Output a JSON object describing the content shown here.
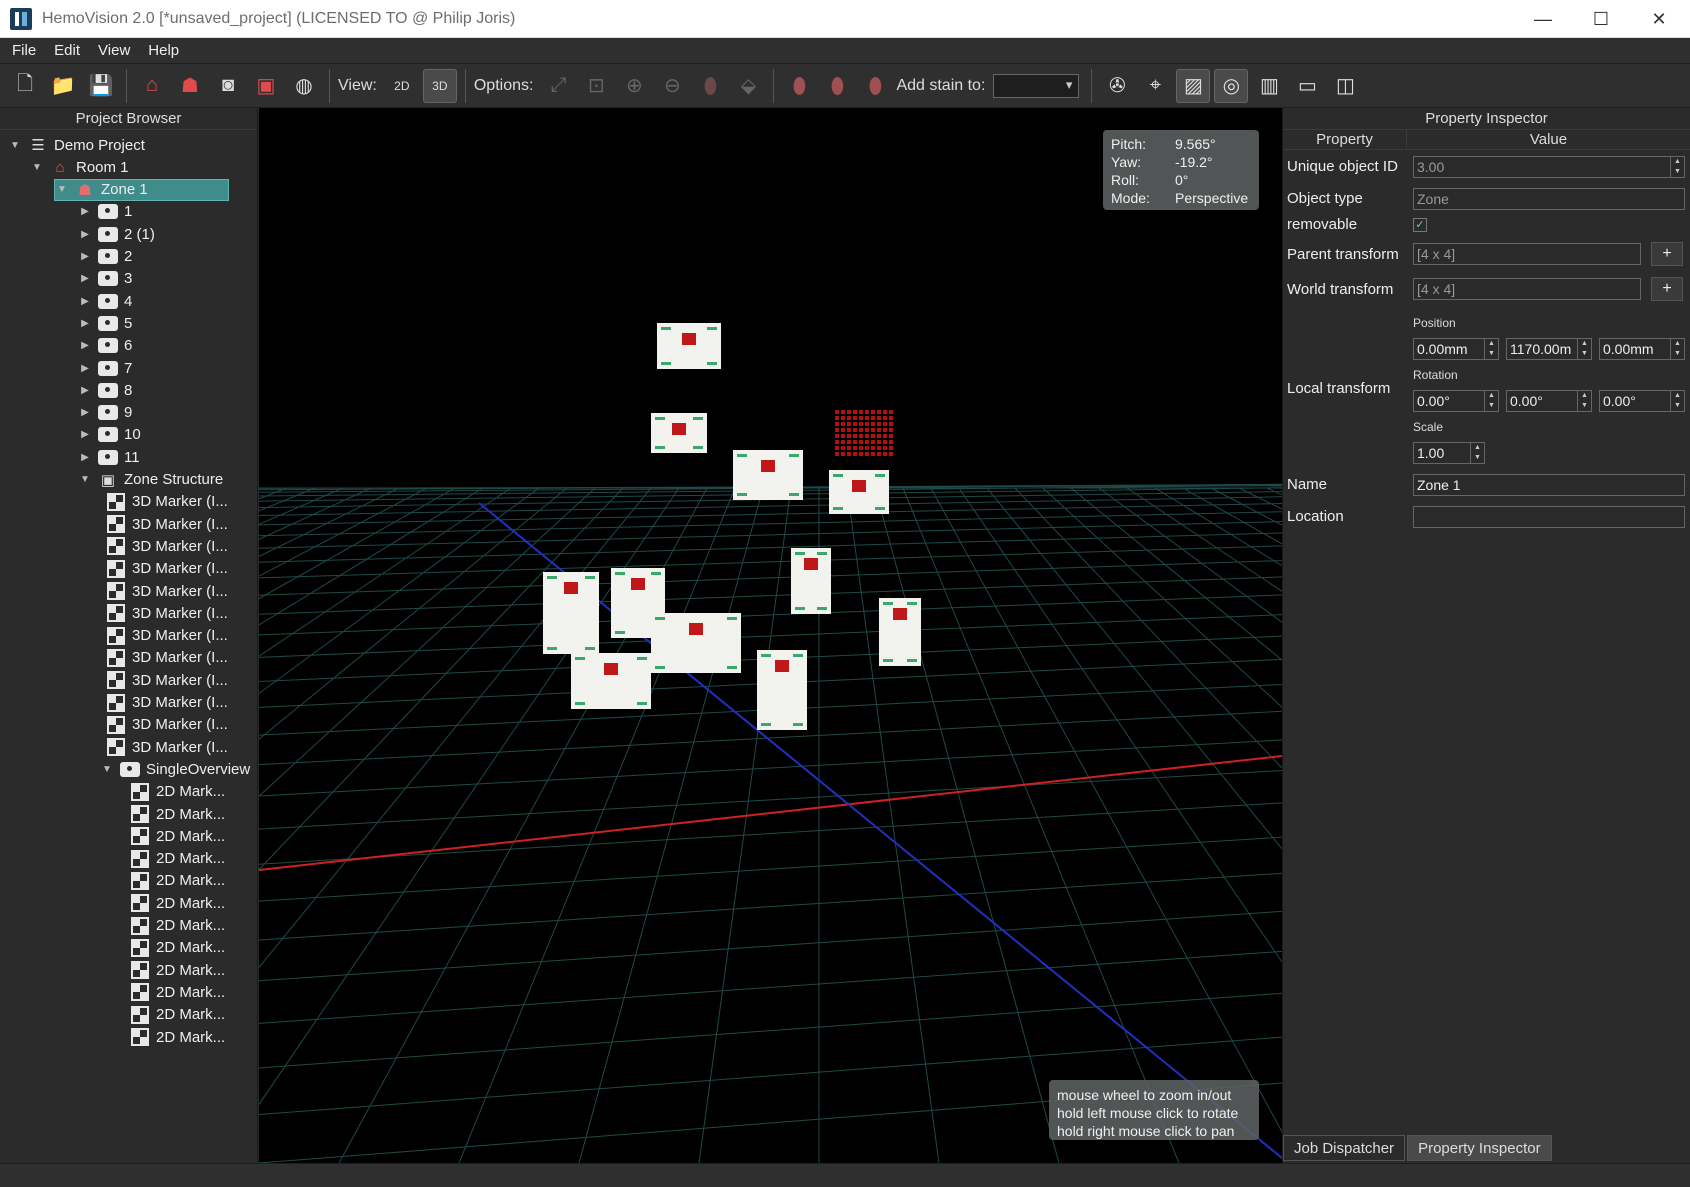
{
  "window": {
    "title": "HemoVision 2.0 [*unsaved_project] (LICENSED TO @ Philip Joris)"
  },
  "menu": [
    "File",
    "Edit",
    "View",
    "Help"
  ],
  "toolbar": {
    "view_label": "View:",
    "view_2d": "2D",
    "view_3d": "3D",
    "options_label": "Options:",
    "add_stain_label": "Add stain to:",
    "add_stain_value": ""
  },
  "project_browser": {
    "title": "Project Browser",
    "root": "Demo Project",
    "room": "Room 1",
    "zone": "Zone 1",
    "cameras": [
      "1",
      "2 (1)",
      "2",
      "3",
      "4",
      "5",
      "6",
      "7",
      "8",
      "9",
      "10",
      "11"
    ],
    "zone_structure": "Zone Structure",
    "markers_3d": [
      "3D Marker (I...",
      "3D Marker (I...",
      "3D Marker (I...",
      "3D Marker (I...",
      "3D Marker (I...",
      "3D Marker (I...",
      "3D Marker (I...",
      "3D Marker (I...",
      "3D Marker (I...",
      "3D Marker (I...",
      "3D Marker (I...",
      "3D Marker (I..."
    ],
    "overview": "SingleOverview",
    "markers_2d": [
      "2D Mark...",
      "2D Mark...",
      "2D Mark...",
      "2D Mark...",
      "2D Mark...",
      "2D Mark...",
      "2D Mark...",
      "2D Mark...",
      "2D Mark...",
      "2D Mark...",
      "2D Mark...",
      "2D Mark..."
    ]
  },
  "viewport": {
    "pitch_label": "Pitch:",
    "pitch": "9.565°",
    "yaw_label": "Yaw:",
    "yaw": "-19.2°",
    "roll_label": "Roll:",
    "roll": "0°",
    "mode_label": "Mode:",
    "mode": "Perspective",
    "hint_1": "mouse wheel to zoom in/out",
    "hint_2": "hold left mouse click to rotate",
    "hint_3": "hold right mouse click to pan"
  },
  "inspector": {
    "title": "Property Inspector",
    "col_property": "Property",
    "col_value": "Value",
    "uid_label": "Unique object ID",
    "uid_value": "3.00",
    "type_label": "Object type",
    "type_value": "Zone",
    "removable_label": "removable",
    "removable_checked": true,
    "parent_label": "Parent transform",
    "parent_value": "[4 x 4]",
    "world_label": "World transform",
    "world_value": "[4 x 4]",
    "plus": "+",
    "local_label": "Local transform",
    "position_label": "Position",
    "pos_x": "0.00mm",
    "pos_y": "1170.00m",
    "pos_z": "0.00mm",
    "rotation_label": "Rotation",
    "rot_x": "0.00°",
    "rot_y": "0.00°",
    "rot_z": "0.00°",
    "scale_label": "Scale",
    "scale": "1.00",
    "name_label": "Name",
    "name_value": "Zone 1",
    "location_label": "Location",
    "location_value": ""
  },
  "tabs": [
    "Job Dispatcher",
    "Property Inspector"
  ],
  "colors": {
    "selection": "#3f8c8a",
    "axis_x": "#d02020",
    "axis_z": "#2030c0",
    "grid": "#1e4a48"
  }
}
